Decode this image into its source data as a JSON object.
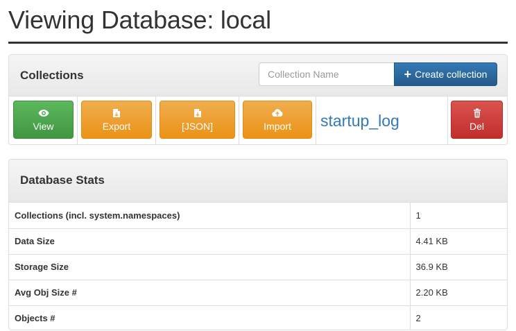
{
  "page": {
    "title": "Viewing Database: local"
  },
  "collections": {
    "heading": "Collections",
    "input_placeholder": "Collection Name",
    "create_label": "Create collection",
    "items": [
      {
        "name": "startup_log",
        "view_label": "View",
        "export_label": "Export",
        "json_label": "[JSON]",
        "import_label": "Import",
        "delete_label": "Del"
      }
    ]
  },
  "stats": {
    "heading": "Database Stats",
    "rows": [
      {
        "label": "Collections (incl. system.namespaces)",
        "value": "1"
      },
      {
        "label": "Data Size",
        "value": "4.41 KB"
      },
      {
        "label": "Storage Size",
        "value": "36.9 KB"
      },
      {
        "label": "Avg Obj Size #",
        "value": "2.20 KB"
      },
      {
        "label": "Objects #",
        "value": "2"
      }
    ]
  },
  "colors": {
    "primary": "#337ab7",
    "success": "#5cb85c",
    "warning": "#f0ad4e",
    "danger": "#d9534f"
  },
  "icons": {
    "view": "eye-icon",
    "export": "export-file-icon",
    "json": "export-file-icon",
    "import": "cloud-upload-icon",
    "delete": "trash-icon",
    "create": "plus-icon"
  }
}
